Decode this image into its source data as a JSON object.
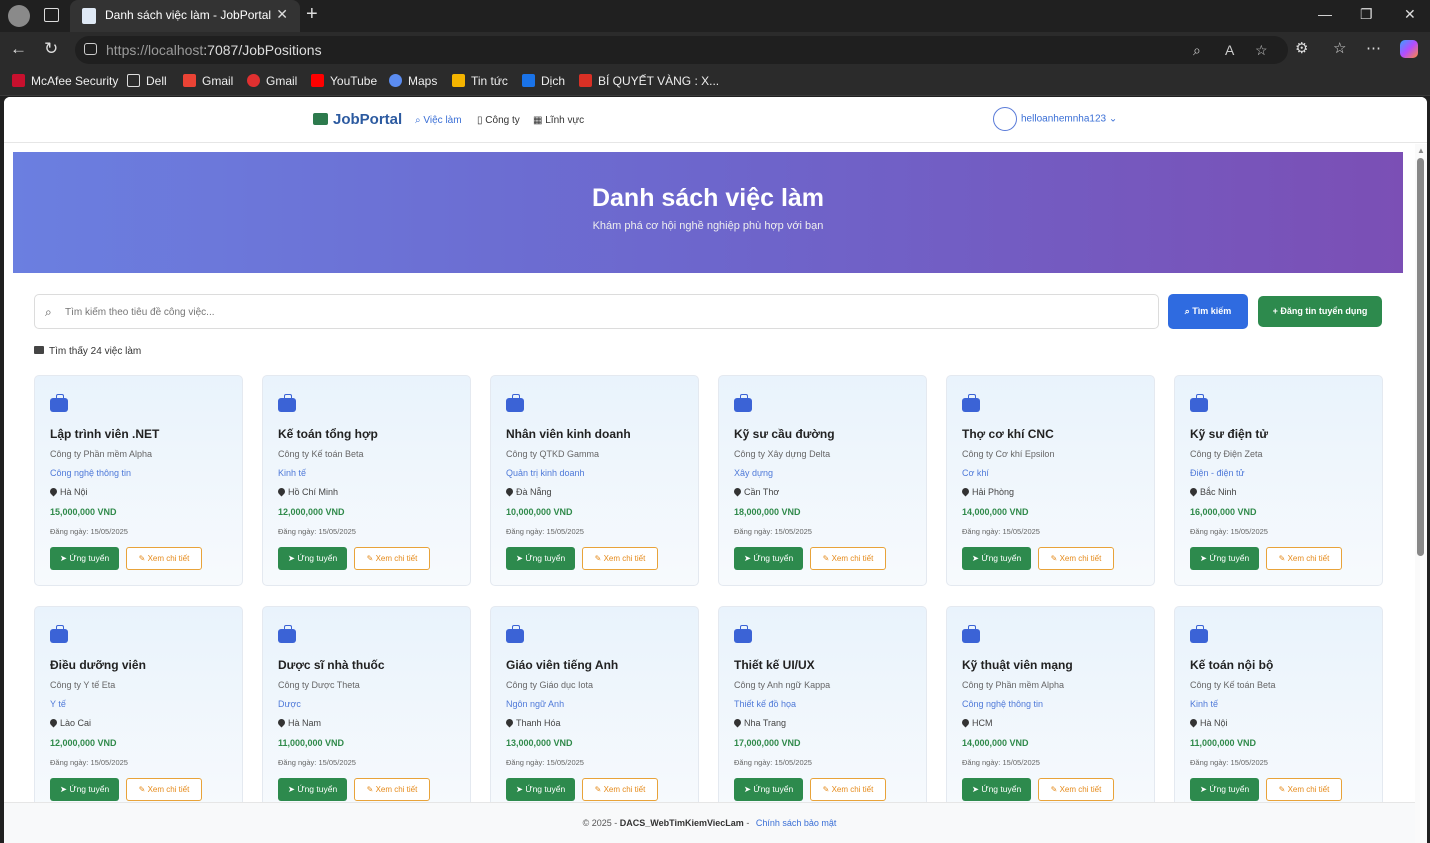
{
  "browser": {
    "tab_title": "Danh sách việc làm - JobPortal",
    "url_host": "https://localhost",
    "url_rest": ":7087/JobPositions",
    "bookmarks": [
      "McAfee Security",
      "Dell",
      "Gmail",
      "Gmail",
      "YouTube",
      "Maps",
      "Tin tức",
      "Dịch",
      "BÍ QUYẾT VÀNG : X..."
    ]
  },
  "site": {
    "brand": "JobPortal",
    "nav": [
      "Việc làm",
      "Công ty",
      "Lĩnh vực"
    ],
    "username": "helloanhemnha123"
  },
  "hero": {
    "title": "Danh sách việc làm",
    "subtitle": "Khám phá cơ hội nghề nghiệp phù hợp với bạn"
  },
  "search": {
    "placeholder": "Tìm kiếm theo tiêu đề công việc...",
    "button": "Tìm kiếm",
    "post_button": "+ Đăng tin tuyển dụng"
  },
  "results_text": "Tìm thấy 24 việc làm",
  "apply_label": "Ứng tuyển",
  "detail_label": "Xem chi tiết",
  "jobs": [
    {
      "title": "Lập trình viên .NET",
      "company": "Công ty Phần mềm Alpha",
      "field": "Công nghệ thông tin",
      "location": "Hà Nội",
      "salary": "15,000,000 VND",
      "date": "Đăng ngày: 15/05/2025"
    },
    {
      "title": "Kế toán tổng hợp",
      "company": "Công ty Kế toán Beta",
      "field": "Kinh tế",
      "location": "Hồ Chí Minh",
      "salary": "12,000,000 VND",
      "date": "Đăng ngày: 15/05/2025"
    },
    {
      "title": "Nhân viên kinh doanh",
      "company": "Công ty QTKD Gamma",
      "field": "Quản trị kinh doanh",
      "location": "Đà Nẵng",
      "salary": "10,000,000 VND",
      "date": "Đăng ngày: 15/05/2025"
    },
    {
      "title": "Kỹ sư cầu đường",
      "company": "Công ty Xây dựng Delta",
      "field": "Xây dựng",
      "location": "Cần Thơ",
      "salary": "18,000,000 VND",
      "date": "Đăng ngày: 15/05/2025"
    },
    {
      "title": "Thợ cơ khí CNC",
      "company": "Công ty Cơ khí Epsilon",
      "field": "Cơ khí",
      "location": "Hải Phòng",
      "salary": "14,000,000 VND",
      "date": "Đăng ngày: 15/05/2025"
    },
    {
      "title": "Kỹ sư điện tử",
      "company": "Công ty Điện Zeta",
      "field": "Điện - điện tử",
      "location": "Bắc Ninh",
      "salary": "16,000,000 VND",
      "date": "Đăng ngày: 15/05/2025"
    },
    {
      "title": "Điều dưỡng viên",
      "company": "Công ty Y tế Eta",
      "field": "Y tế",
      "location": "Lào Cai",
      "salary": "12,000,000 VND",
      "date": "Đăng ngày: 15/05/2025"
    },
    {
      "title": "Dược sĩ nhà thuốc",
      "company": "Công ty Dược Theta",
      "field": "Dược",
      "location": "Hà Nam",
      "salary": "11,000,000 VND",
      "date": "Đăng ngày: 15/05/2025"
    },
    {
      "title": "Giáo viên tiếng Anh",
      "company": "Công ty Giáo dục Iota",
      "field": "Ngôn ngữ Anh",
      "location": "Thanh Hóa",
      "salary": "13,000,000 VND",
      "date": "Đăng ngày: 15/05/2025"
    },
    {
      "title": "Thiết kế UI/UX",
      "company": "Công ty Anh ngữ Kappa",
      "field": "Thiết kế đồ họa",
      "location": "Nha Trang",
      "salary": "17,000,000 VND",
      "date": "Đăng ngày: 15/05/2025"
    },
    {
      "title": "Kỹ thuật viên mạng",
      "company": "Công ty Phần mềm Alpha",
      "field": "Công nghệ thông tin",
      "location": "HCM",
      "salary": "14,000,000 VND",
      "date": "Đăng ngày: 15/05/2025"
    },
    {
      "title": "Kế toán nội bộ",
      "company": "Công ty Kế toán Beta",
      "field": "Kinh tế",
      "location": "Hà Nội",
      "salary": "11,000,000 VND",
      "date": "Đăng ngày: 15/05/2025"
    }
  ],
  "footer": {
    "copyright": "© 2025 -",
    "project": "DACS_WebTimKiemViecLam",
    "separator": "-",
    "privacy": "Chính sách bảo mật"
  }
}
